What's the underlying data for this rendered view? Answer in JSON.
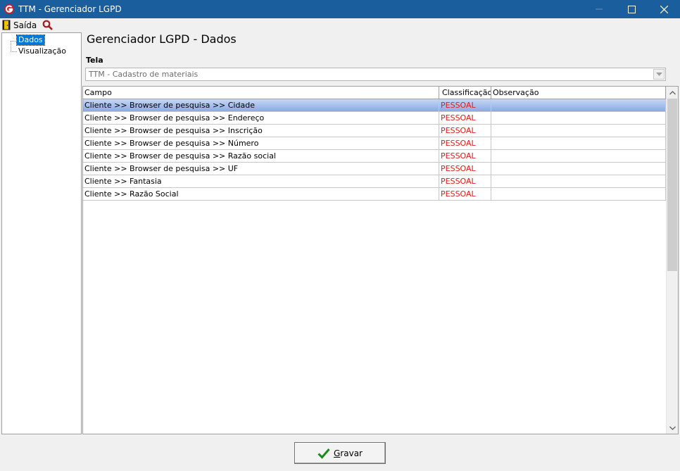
{
  "window": {
    "title": "TTM - Gerenciador LGPD"
  },
  "menu": {
    "exit_label": "Saída",
    "search_icon": "magnifier-icon"
  },
  "tree": {
    "items": [
      {
        "label": "Dados",
        "selected": true
      },
      {
        "label": "Visualização",
        "selected": false
      }
    ]
  },
  "main": {
    "title": "Gerenciador LGPD - Dados",
    "screen_label": "Tela",
    "screen_value": "TTM - Cadastro de materiais"
  },
  "grid": {
    "columns": [
      "Campo",
      "Classificação",
      "Observação"
    ],
    "rows": [
      {
        "campo": "Cliente >> Browser de pesquisa >> Cidade",
        "classificacao": "PESSOAL",
        "observacao": "",
        "selected": true
      },
      {
        "campo": "Cliente >> Browser de pesquisa >> Endereço",
        "classificacao": "PESSOAL",
        "observacao": ""
      },
      {
        "campo": "Cliente >> Browser de pesquisa >> Inscrição",
        "classificacao": "PESSOAL",
        "observacao": ""
      },
      {
        "campo": "Cliente >> Browser de pesquisa >> Número",
        "classificacao": "PESSOAL",
        "observacao": ""
      },
      {
        "campo": "Cliente >> Browser de pesquisa >> Razão social",
        "classificacao": "PESSOAL",
        "observacao": ""
      },
      {
        "campo": "Cliente >> Browser de pesquisa >> UF",
        "classificacao": "PESSOAL",
        "observacao": ""
      },
      {
        "campo": "Cliente >> Fantasia",
        "classificacao": "PESSOAL",
        "observacao": ""
      },
      {
        "campo": "Cliente >> Razão Social",
        "classificacao": "PESSOAL",
        "observacao": ""
      }
    ]
  },
  "footer": {
    "save_label": "Gravar"
  },
  "colors": {
    "titlebar": "#1b5e9e",
    "selection": "#0078d7",
    "classification": "#e01b1b"
  }
}
